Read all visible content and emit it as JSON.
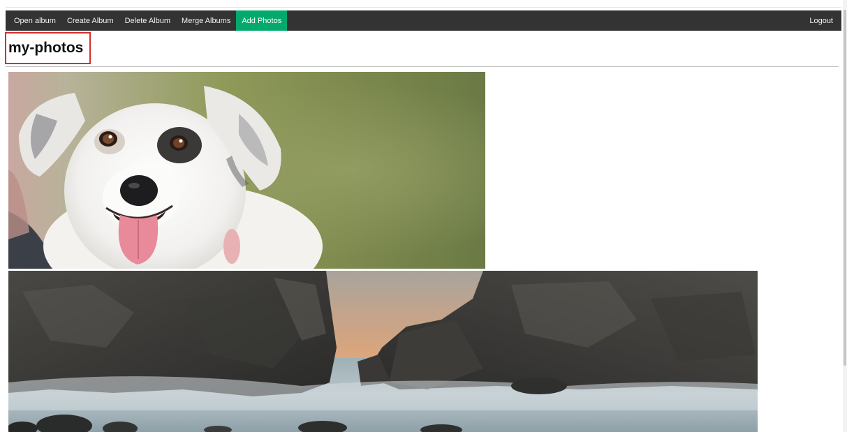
{
  "navbar": {
    "items": [
      {
        "label": "Open album"
      },
      {
        "label": "Create Album"
      },
      {
        "label": "Delete Album"
      },
      {
        "label": "Merge Albums"
      },
      {
        "label": "Add Photos",
        "active": true
      }
    ],
    "logout_label": "Logout"
  },
  "album": {
    "title": "my-photos"
  },
  "photos": [
    {
      "subject": "dog"
    },
    {
      "subject": "seascape"
    }
  ],
  "colors": {
    "navbar_bg": "#333333",
    "active_tab": "#04aa6d",
    "highlight_border": "#d32f2f"
  }
}
